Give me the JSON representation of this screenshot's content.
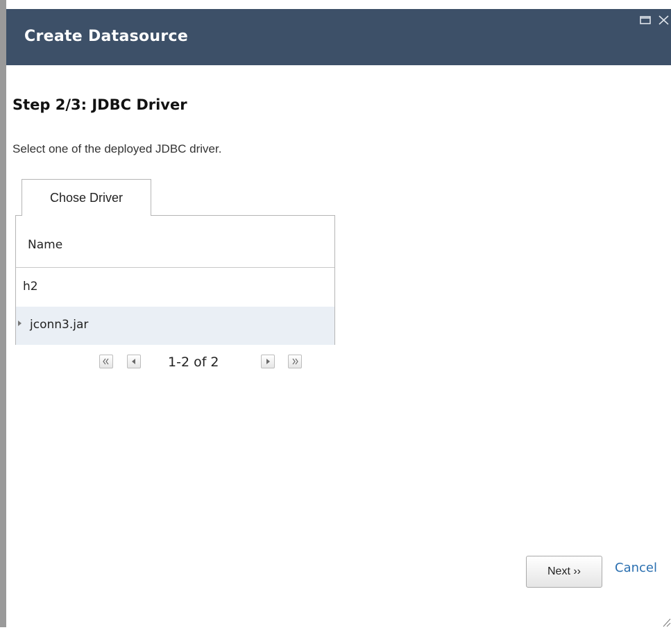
{
  "window": {
    "title": "Create Datasource",
    "maximize_icon": "maximize-icon",
    "close_icon": "close-icon"
  },
  "step": {
    "title": "Step 2/3: JDBC Driver",
    "description": "Select one of the deployed JDBC driver."
  },
  "tabs": [
    {
      "label": "Chose Driver",
      "active": true
    }
  ],
  "table": {
    "columns": [
      "Name"
    ],
    "rows": [
      {
        "name": "h2",
        "selected": false
      },
      {
        "name": "jconn3.jar",
        "selected": true
      }
    ]
  },
  "pager": {
    "text": "1-2 of 2",
    "first_icon": "first-page-icon",
    "prev_icon": "prev-page-icon",
    "next_icon": "next-page-icon",
    "last_icon": "last-page-icon"
  },
  "footer": {
    "next_label": "Next ››",
    "cancel_label": "Cancel"
  },
  "colors": {
    "titlebar": "#3d5068",
    "selected_row": "#eaeff5",
    "link": "#2a6fb0"
  }
}
